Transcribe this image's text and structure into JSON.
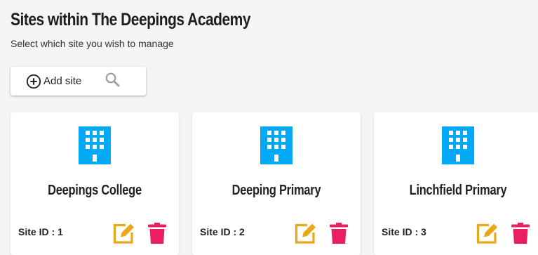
{
  "header": {
    "title": "Sites within The Deepings Academy",
    "subtitle": "Select which site you wish to manage"
  },
  "toolbar": {
    "add_label": "Add site",
    "add_icon": "plus-circle-icon",
    "search_icon": "search-icon"
  },
  "colors": {
    "building": "#03a9f4",
    "edit": "#e8a817",
    "delete": "#e91e63"
  },
  "sites": [
    {
      "name": "Deepings College",
      "id_label": "Site ID : 1"
    },
    {
      "name": "Deeping Primary",
      "id_label": "Site ID : 2"
    },
    {
      "name": "Linchfield Primary",
      "id_label": "Site ID : 3"
    }
  ]
}
